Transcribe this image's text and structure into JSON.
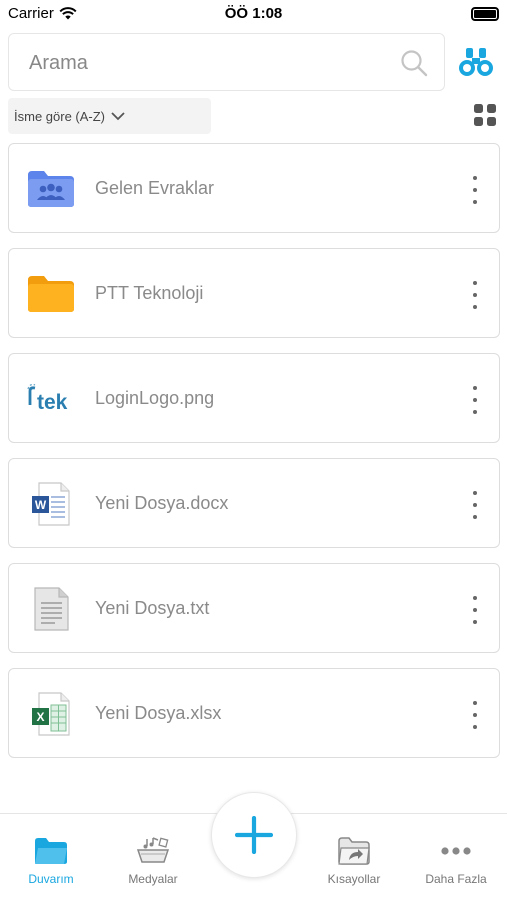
{
  "status_bar": {
    "carrier": "Carrier",
    "time": "ÖÖ 1:08"
  },
  "search": {
    "placeholder": "Arama",
    "value": ""
  },
  "sort": {
    "label": "İsme göre (A-Z)"
  },
  "files": [
    {
      "name": "Gelen Evraklar",
      "icon": "shared-folder-icon"
    },
    {
      "name": "PTT Teknoloji",
      "icon": "folder-icon"
    },
    {
      "name": "LoginLogo.png",
      "icon": "image-thumbnail-icon",
      "thumbnail_text": "tek"
    },
    {
      "name": "Yeni Dosya.docx",
      "icon": "word-document-icon"
    },
    {
      "name": "Yeni Dosya.txt",
      "icon": "text-document-icon"
    },
    {
      "name": "Yeni Dosya.xlsx",
      "icon": "excel-document-icon"
    }
  ],
  "tabs": [
    {
      "label": "Duvarım",
      "icon": "folder-icon",
      "active": true
    },
    {
      "label": "Medyalar",
      "icon": "media-icon",
      "active": false
    },
    {
      "label": "Kısayollar",
      "icon": "shortcuts-icon",
      "active": false
    },
    {
      "label": "Daha Fazla",
      "icon": "more-horizontal-icon",
      "active": false
    }
  ],
  "colors": {
    "accent": "#1aa7e0",
    "shared_folder": "#7b9cf0",
    "folder": "#ffb21f",
    "word": "#2b579a",
    "excel": "#217346"
  }
}
